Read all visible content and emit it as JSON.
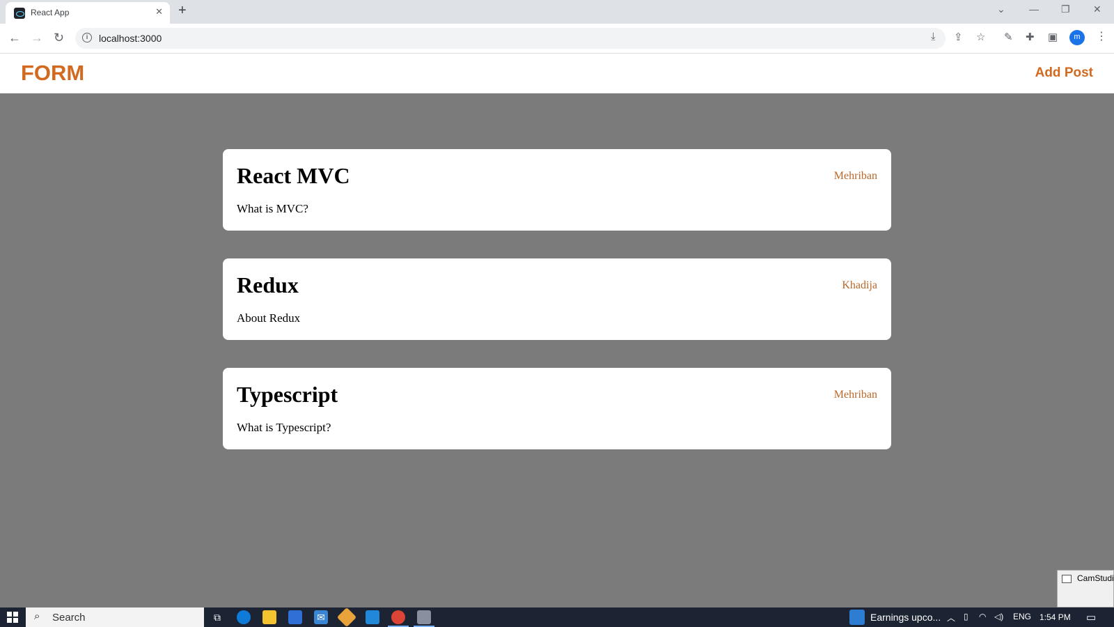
{
  "browser": {
    "tab_title": "React App",
    "tab_close": "✕",
    "new_tab": "+",
    "url": "localhost:3000"
  },
  "app": {
    "logo": "FORM",
    "add_post_label": "Add Post",
    "accent_color": "#d2691e"
  },
  "posts": [
    {
      "title": "React MVC",
      "author": "Mehriban",
      "body": "What is MVC?"
    },
    {
      "title": "Redux",
      "author": "Khadija",
      "body": "About Redux"
    },
    {
      "title": "Typescript",
      "author": "Mehriban",
      "body": "What is Typescript?"
    }
  ],
  "camstudio": {
    "title": "CamStudio"
  },
  "taskbar": {
    "search_label": "Search",
    "news": "Earnings upco...",
    "language": "ENG",
    "time": "1:54 PM"
  },
  "profile_initial": "m"
}
